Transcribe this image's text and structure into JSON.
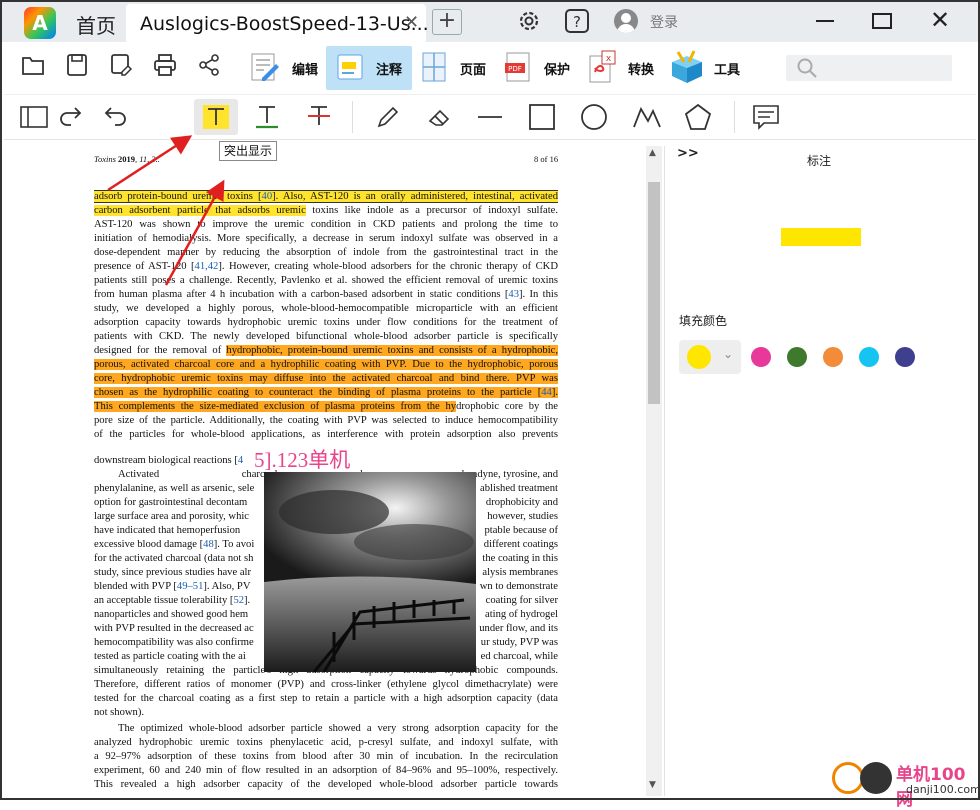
{
  "titlebar": {
    "home_tab": "首页",
    "doc_tab_title": "Auslogics-BoostSpeed-13-Us...",
    "close_tab": "✕",
    "new_tab": "+",
    "login": "登录"
  },
  "toolbar": {
    "groups": [
      {
        "label": "编辑",
        "icon": "edit-icon"
      },
      {
        "label": "注释",
        "icon": "annotate-icon",
        "active": true
      },
      {
        "label": "页面",
        "icon": "page-icon"
      },
      {
        "label": "保护",
        "icon": "protect-pdf-icon"
      },
      {
        "label": "转换",
        "icon": "convert-icon"
      },
      {
        "label": "工具",
        "icon": "tools-icon"
      }
    ],
    "search_placeholder": ""
  },
  "annotation_tools": {
    "tooltip": "突出显示",
    "tools": [
      "sidebar-toggle-icon",
      "redo-icon",
      "undo-icon",
      "highlight-text-icon",
      "underline-text-icon",
      "strikethrough-text-icon",
      "pencil-icon",
      "eraser-icon",
      "line-icon",
      "rectangle-icon",
      "circle-icon",
      "polyline-icon",
      "polygon-icon",
      "comment-icon"
    ]
  },
  "document": {
    "header_left_journal": "Toxins",
    "header_left_year": "2019",
    "header_left_rest": ", 11, 3..",
    "header_right": "8 of 16",
    "lines": {
      "l1_a": "adsorb protein-bound uremic toxins [",
      "l1_ref": "40",
      "l1_b": "]. Also, AST-120 is an orally administered, intestinal, activated",
      "l2_a": "carbon adsorbent particle that adsorbs uremic",
      "l2_b": " toxins like indole as a precursor of indoxyl sulfate.",
      "l3": "AST-120 was shown to improve the uremic condition in CKD patients and prolong the time to",
      "l4": "initiation of hemodialysis. More specifically, a decrease in serum indoxyl sulfate was observed in a",
      "l5": "dose-dependent manner by reducing the absorption of indole from the gastrointestinal tract in the",
      "l6_a": "presence of AST-120 [",
      "l6_ref": "41,42",
      "l6_b": "]. However, creating whole-blood adsorbers for the chronic therapy of CKD",
      "l7": "patients still poses a challenge. Recently, Pavlenko et al. showed the efficient removal of uremic toxins",
      "l8_a": "from human plasma after 4 h incubation with a carbon-based adsorbent in static conditions [",
      "l8_ref": "43",
      "l8_b": "]. In this",
      "l9": "study, we developed a highly porous, whole-blood-hemocompatible microparticle with an efficient",
      "l10": "adsorption capacity towards hydrophobic uremic toxins under flow conditions for the treatment of",
      "l11": "patients with CKD. The newly developed bifunctional whole-blood adsorber particle is specifically",
      "l12_a": "designed for the removal of ",
      "l12_b": "hydrophobic, protein-bound uremic toxins and consists of a hydrophobic,",
      "l13": "porous, activated charcoal core and a hydrophilic coating with PVP. Due to the hydrophobic, porous",
      "l14": "core, hydrophobic uremic toxins may diffuse into the activated charcoal and bind there.  PVP was",
      "l15_a": "chosen as the hydrophilic coating to counteract the binding of plasma proteins to the particle [",
      "l15_ref": "44",
      "l15_b": "].",
      "l16_a": "This complements the size-mediated exclusion of plasma proteins from the hy",
      "l16_b": "drophobic core by the",
      "l17": "pore size of the particle.  Additionally, the coating with PVP was selected to induce hemocompatibility",
      "l18": "of the particles for whole-blood applications, as interference with protein adsorption also prevents",
      "l19_a": "downstream biological reactions [",
      "l19_ref": "4",
      "l20_a": "Activated charcoal has already",
      "l20_b": "ne, tyrosine, and",
      "l21_a": "phenylalanine, as well as arsenic, sele",
      "l21_b": "ablished treatment",
      "l22_a": "option for gastrointestinal decontam",
      "l22_b": "drophobicity and",
      "l23_a": "large surface area and porosity, whic",
      "l23_b": "however, studies",
      "l24_a": "have indicated that hemoperfusion",
      "l24_b": "ptable because of",
      "l25_a": "excessive blood damage [",
      "l25_ref": "48",
      "l25_b": "]. To avoi",
      "l25_c": "different coatings",
      "l26_a": "for the activated charcoal (data not sh",
      "l26_b": "the coating in this",
      "l27_a": "study, since previous studies have alr",
      "l27_b": "alysis membranes",
      "l28_a": "blended with PVP [",
      "l28_ref": "49–51",
      "l28_b": "]. Also, PV",
      "l28_c": "wn to demonstrate",
      "l29_a": "an acceptable tissue tolerability [",
      "l29_ref": "52",
      "l29_b": "].",
      "l29_c": "coating for silver",
      "l30_a": "nanoparticles and showed good hem",
      "l30_b": "ating of hydrogel",
      "l31_a": "with PVP resulted in the decreased ac",
      "l31_b": "under flow, and its",
      "l32_a": "hemocompatibility was also confirme",
      "l32_b": "ur study, PVP was",
      "l33_a": "tested as particle coating with the ai",
      "l33_b": "ed charcoal, while",
      "l34": "simultaneously retaining the particle's high adsorption capacity towards hydrophobic compounds.",
      "l35": "Therefore, different ratios of monomer (PVP) and cross-linker (ethylene glycol dimethacrylate) were",
      "l36": "tested for the charcoal coating as a first step to retain a particle with a high adsorption capacity (data",
      "l37": "not shown).",
      "l38": "The optimized whole-blood adsorber particle showed a very strong adsorption capacity for the",
      "l39": "analyzed hydrophobic uremic toxins phenylacetic acid, p-cresyl sulfate, and indoxyl sulfate, with",
      "l40": "a 92–97% adsorption of these toxins from blood after 30 min of incubation.  In the recirculation",
      "l41": "experiment, 60 and 240 min of flow resulted in an adsorption of 84–96% and 95–100%, respectively.",
      "l42": "This revealed a high adsorber capacity of the developed whole-blood adsorber particle towards"
    },
    "watermark": "5].123单机"
  },
  "panel": {
    "collapse": ">>",
    "title": "标注",
    "fill_label": "填充颜色",
    "selected_color": "#ffe600",
    "swatches": [
      "#e8399a",
      "#3d7a2e",
      "#f28c38",
      "#16c4f2",
      "#3f3f8f"
    ]
  },
  "watermark_site": {
    "cn": "单机100网",
    "en": "danji100.com"
  },
  "colors": {
    "highlight_yellow": "#ffe32c",
    "highlight_orange": "#ffa71f",
    "annotate_active": "#bfe1f7",
    "arrow": "#e02020"
  }
}
